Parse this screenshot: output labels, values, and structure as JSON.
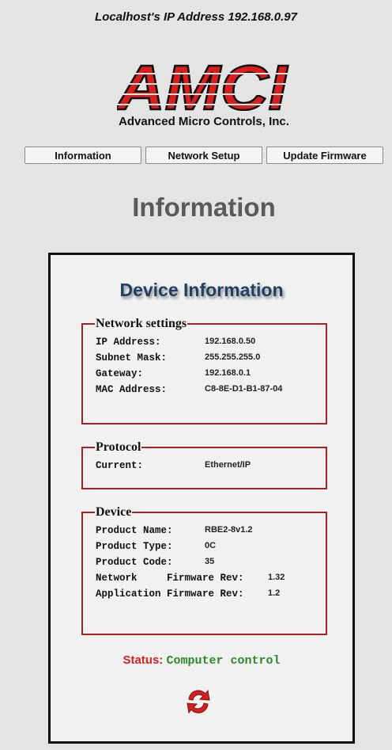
{
  "header": {
    "ip_text": "Localhost's IP Address 192.168.0.97"
  },
  "logo": {
    "text": "AMCI",
    "company": "Advanced Micro Controls, Inc.",
    "color": "#d91e1e"
  },
  "nav": {
    "information": "Information",
    "network_setup": "Network Setup",
    "update_firmware": "Update Firmware"
  },
  "page": {
    "title": "Information"
  },
  "panel": {
    "title": "Device Information",
    "network": {
      "legend": "Network settings",
      "rows": [
        {
          "label": "IP Address:",
          "value": "192.168.0.50"
        },
        {
          "label": "Subnet Mask:",
          "value": "255.255.255.0"
        },
        {
          "label": "Gateway:",
          "value": "192.168.0.1"
        },
        {
          "label": "MAC Address:",
          "value": "C8-8E-D1-B1-87-04"
        }
      ]
    },
    "protocol": {
      "legend": "Protocol",
      "rows": [
        {
          "label": "Current:",
          "value": "Ethernet/IP"
        }
      ]
    },
    "device": {
      "legend": "Device",
      "rows": [
        {
          "label": "Product Name:",
          "value": "RBE2-8v1.2"
        },
        {
          "label": "Product Type:",
          "value": "0C"
        },
        {
          "label": "Product Code:",
          "value": "35"
        },
        {
          "label": "Network     Firmware Rev:",
          "value": "1.32"
        },
        {
          "label": "Application Firmware Rev:",
          "value": "1.2"
        }
      ]
    },
    "status": {
      "label": "Status:",
      "value": "Computer control"
    }
  },
  "icons": {
    "refresh": "refresh-icon"
  },
  "colors": {
    "accent_red": "#a32424",
    "status_green": "#2a8a2a",
    "title_blue": "#1f3f63"
  }
}
